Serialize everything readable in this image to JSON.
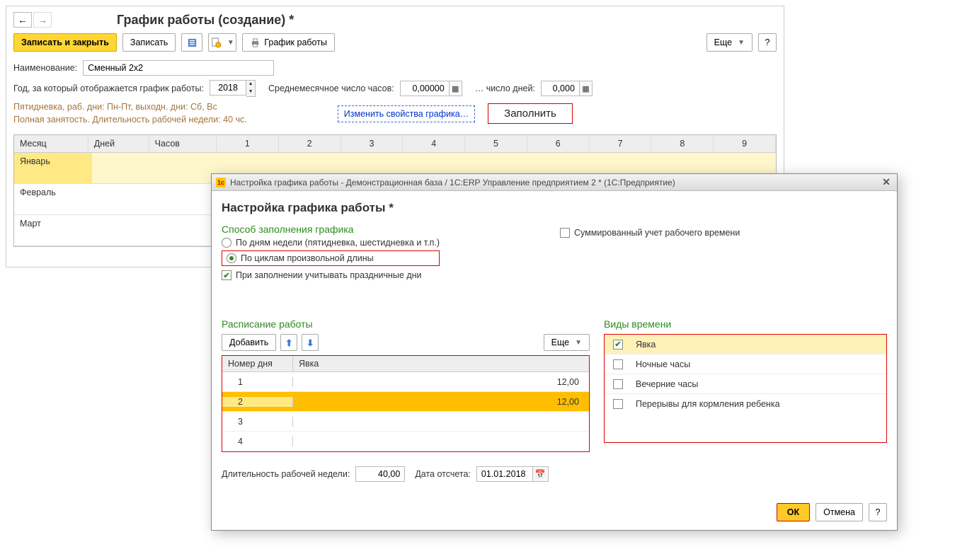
{
  "main": {
    "title": "График работы (создание) *",
    "toolbar": {
      "save_close": "Записать и закрыть",
      "save": "Записать",
      "print_label": "График работы",
      "more": "Еще",
      "help": "?"
    },
    "name_label": "Наименование:",
    "name_value": "Сменный 2х2",
    "year_label": "Год, за который отображается график работы:",
    "year_value": "2018",
    "avg_hours_label": "Среднемесячное число часов:",
    "avg_hours_value": "0,00000",
    "days_label": "… число дней:",
    "days_value": "0,000",
    "desc_line1": "Пятидневка, раб. дни: Пн-Пт, выходн. дни: Сб, Вс",
    "desc_line2": "Полная занятость. Длительность рабочей недели: 40 чс.",
    "link_change": "Изменить свойства графика…",
    "fill_btn": "Заполнить",
    "table": {
      "headers": {
        "month": "Месяц",
        "days": "Дней",
        "hours": "Часов"
      },
      "day_cols": [
        "1",
        "2",
        "3",
        "4",
        "5",
        "6",
        "7",
        "8",
        "9"
      ],
      "rows": [
        {
          "month": "Январь"
        },
        {
          "month": "Февраль"
        },
        {
          "month": "Март"
        }
      ]
    }
  },
  "modal": {
    "titlebar": "Настройка графика работы - Демонстрационная база / 1С:ERP Управление предприятием 2 *  (1С:Предприятие)",
    "title": "Настройка графика работы *",
    "method_label": "Способ заполнения графика",
    "cum_label": "Суммированный учет рабочего времени",
    "radio1": "По дням недели (пятидневка, шестидневка и т.п.)",
    "radio2": "По циклам произвольной длины",
    "holidays_cb": "При заполнении учитывать праздничные дни",
    "left": {
      "title": "Расписание работы",
      "add": "Добавить",
      "more": "Еще",
      "headers": {
        "day": "Номер дня",
        "yav": "Явка"
      },
      "rows": [
        {
          "n": "1",
          "v": "12,00"
        },
        {
          "n": "2",
          "v": "12,00"
        },
        {
          "n": "3",
          "v": ""
        },
        {
          "n": "4",
          "v": ""
        }
      ]
    },
    "right": {
      "title": "Виды времени",
      "rows": [
        {
          "label": "Явка",
          "checked": true
        },
        {
          "label": "Ночные часы",
          "checked": false
        },
        {
          "label": "Вечерние часы",
          "checked": false
        },
        {
          "label": "Перерывы для кормления ребенка",
          "checked": false
        }
      ]
    },
    "week_len_label": "Длительность рабочей недели:",
    "week_len_value": "40,00",
    "date_label": "Дата отсчета:",
    "date_value": "01.01.2018",
    "ok": "ОК",
    "cancel": "Отмена",
    "help": "?"
  }
}
